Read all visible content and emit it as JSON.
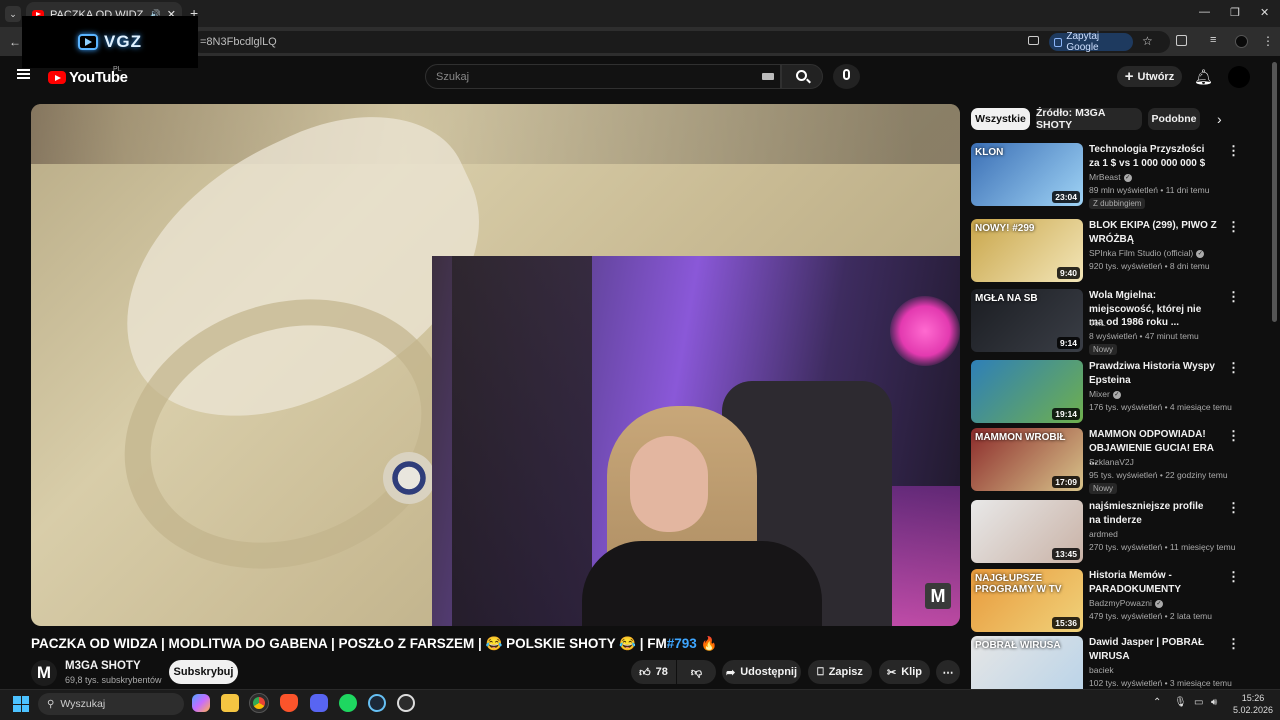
{
  "browser": {
    "tab_title": "PACZKA OD WIDZA | MOD",
    "url_fragment": "=8N3FbcdlglLQ",
    "ask_google": "Zapytaj Google",
    "overlay_logo": "VGZ"
  },
  "header": {
    "logo": "YouTube",
    "region": "PL",
    "search_placeholder": "Szukaj",
    "create_label": "Utwórz"
  },
  "video": {
    "title_main": "PACZKA OD WIDZA | MODLITWA DO GABENA | POSZŁO Z FARSZEM | 😂 POLSKIE SHOTY 😂 | FM",
    "title_tag": "#793",
    "title_end": " 🔥",
    "watermark": "M",
    "channel_avatar": "M",
    "channel_name": "M3GA SHOTY",
    "channel_subs": "69,8 tys. subskrybentów",
    "subscribe": "Subskrybuj",
    "likes": "78",
    "share": "Udostępnij",
    "save": "Zapisz",
    "clip": "Klip"
  },
  "chips": [
    "Wszystkie",
    "Źródło: M3GA SHOTY",
    "Podobne"
  ],
  "recommendations": [
    {
      "title": "Technologia Przyszłości za 1 $ vs 1 000 000 000 $",
      "channel": "MrBeast",
      "verified": true,
      "meta": "89 mln wyświetleń • 11 dni temu",
      "badge": "Z dubbingiem",
      "duration": "23:04",
      "label": "KLON",
      "colors": [
        "#3b6fb5",
        "#9fd3f5"
      ]
    },
    {
      "title": "BLOK EKIPA (299), PIWO Z WRÓŻBĄ",
      "channel": "SPInka Film Studio (official)",
      "verified": true,
      "meta": "920 tys. wyświetleń • 8 dni temu",
      "badge": "",
      "duration": "9:40",
      "label": "NOWY! #299",
      "colors": [
        "#c9a64b",
        "#f3e6b8"
      ]
    },
    {
      "title": "Wola Mgielna: miejscowość, której nie ma od 1986 roku ...",
      "channel": "VeiL",
      "verified": false,
      "meta": "8 wyświetleń • 47 minut temu",
      "badge": "Nowy",
      "duration": "9:14",
      "label": "MGŁA NA SB",
      "colors": [
        "#1b1d22",
        "#3a3e46"
      ]
    },
    {
      "title": "Prawdziwa Historia Wyspy Epsteina",
      "channel": "Mixer",
      "verified": true,
      "meta": "176 tys. wyświetleń • 4 miesiące temu",
      "badge": "",
      "duration": "19:14",
      "label": "",
      "colors": [
        "#2e7fb8",
        "#6fb04d"
      ]
    },
    {
      "title": "MAMMON ODPOWIADA! OBJAWIENIE GUCIA! ERA ...",
      "channel": "SzklanaV2J",
      "verified": false,
      "meta": "95 tys. wyświetleń • 22 godziny temu",
      "badge": "Nowy",
      "duration": "17:09",
      "label": "MAMMON WROBIŁ",
      "colors": [
        "#8c2b2b",
        "#d8c48b"
      ]
    },
    {
      "title": "najśmieszniejsze profile na tinderze",
      "channel": "ardmed",
      "verified": false,
      "meta": "270 tys. wyświetleń • 11 miesięcy temu",
      "badge": "",
      "duration": "13:45",
      "label": "",
      "colors": [
        "#e8e8e8",
        "#c9b2a6"
      ]
    },
    {
      "title": "Historia Memów - PARADOKUMENTY",
      "channel": "BadzmyPowazni",
      "verified": true,
      "meta": "479 tys. wyświetleń • 2 lata temu",
      "badge": "",
      "duration": "15:36",
      "label": "NAJGŁUPSZE PROGRAMY W TV",
      "colors": [
        "#e89a3c",
        "#f0d27a"
      ]
    },
    {
      "title": "Dawid Jasper | POBRAŁ WIRUSA",
      "channel": "baciek",
      "verified": false,
      "meta": "102 tys. wyświetleń • 3 miesiące temu",
      "badge": "",
      "duration": "",
      "label": "POBRAŁ WIRUSA",
      "colors": [
        "#e6e6e6",
        "#b9d3e8"
      ]
    }
  ],
  "taskbar": {
    "search": "Wyszukaj",
    "time": "15:26",
    "date": "5.02.2026"
  }
}
